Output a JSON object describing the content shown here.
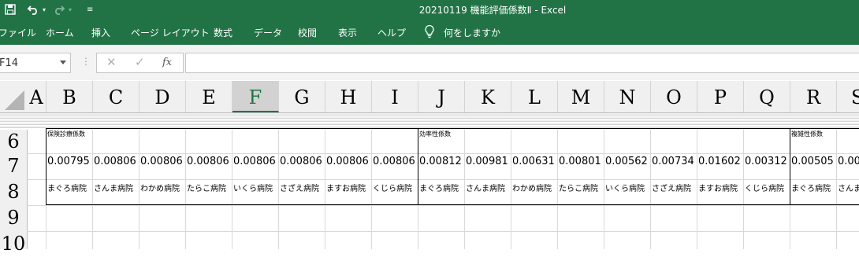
{
  "window": {
    "title": "20210119 機能評価係数Ⅱ  -  Excel",
    "quick_access": {
      "save_icon": "save-icon",
      "undo_icon": "undo-icon",
      "redo_icon": "redo-icon",
      "customize_icon": "customize-icon"
    }
  },
  "ribbon": {
    "tabs": [
      "ファイル",
      "ホーム",
      "挿入",
      "ページ レイアウト",
      "数式",
      "データ",
      "校閲",
      "表示",
      "ヘルプ"
    ],
    "tell_me": "何をしますか"
  },
  "formula_bar": {
    "name_box": "F14",
    "cancel_icon": "✕",
    "enter_icon": "✓",
    "fx_label": "fx",
    "formula": ""
  },
  "columns": [
    "A",
    "B",
    "C",
    "D",
    "E",
    "F",
    "G",
    "H",
    "I",
    "J",
    "K",
    "L",
    "M",
    "N",
    "O",
    "P",
    "Q",
    "R",
    "S"
  ],
  "selected_column": "F",
  "rows": [
    "6",
    "7",
    "8",
    "9",
    "10"
  ],
  "sheet": {
    "sections": [
      {
        "label": "保険診療係数",
        "values": [
          "0.00795",
          "0.00806",
          "0.00806",
          "0.00806",
          "0.00806",
          "0.00806",
          "0.00806",
          "0.00806"
        ],
        "hospitals": [
          "まぐろ病院",
          "さんま病院",
          "わかめ病院",
          "たらこ病院",
          "いくら病院",
          "さざえ病院",
          "ますお病院",
          "くじら病院"
        ]
      },
      {
        "label": "効率性係数",
        "values": [
          "0.00812",
          "0.00981",
          "0.00631",
          "0.00801",
          "0.00562",
          "0.00734",
          "0.01602",
          "0.00312"
        ],
        "hospitals": [
          "まぐろ病院",
          "さんま病院",
          "わかめ病院",
          "たらこ病院",
          "いくら病院",
          "さざえ病院",
          "ますお病院",
          "くじら病院"
        ]
      },
      {
        "label": "複雑性係数",
        "values": [
          "0.00505",
          "0.00"
        ],
        "hospitals": [
          "まぐろ病院",
          "さんま"
        ]
      }
    ]
  },
  "colors": {
    "excel_green": "#217346",
    "grid_line": "#d9d9d9",
    "header_bg": "#f0f0f0"
  }
}
